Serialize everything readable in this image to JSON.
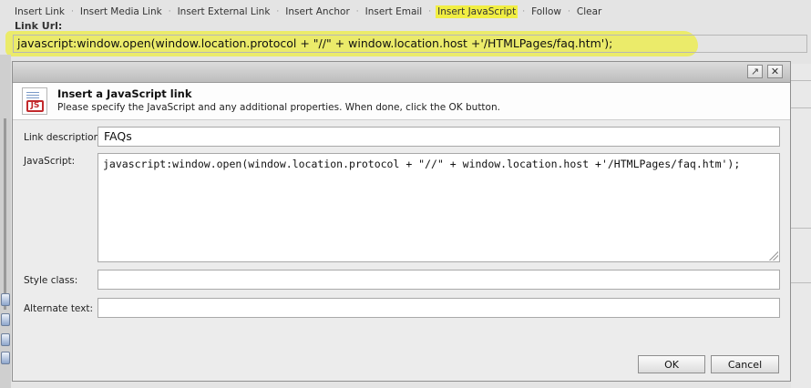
{
  "toolbar": {
    "items": [
      {
        "label": "Insert Link",
        "active": false
      },
      {
        "label": "Insert Media Link",
        "active": false
      },
      {
        "label": "Insert External Link",
        "active": false
      },
      {
        "label": "Insert Anchor",
        "active": false
      },
      {
        "label": "Insert Email",
        "active": false
      },
      {
        "label": "Insert JavaScript",
        "active": true
      },
      {
        "label": "Follow",
        "active": false
      },
      {
        "label": "Clear",
        "active": false
      }
    ],
    "highlight_color": "#f1ee42"
  },
  "link_url": {
    "label": "Link Url:",
    "value": "javascript:window.open(window.location.protocol + \"//\" + window.location.host +'/HTMLPages/faq.htm');"
  },
  "dialog": {
    "icon": "javascript-file-icon",
    "icon_text": "JS",
    "title": "Insert a JavaScript link",
    "subtitle": "Please specify the JavaScript and any additional properties. When done, click the OK button.",
    "fields": {
      "link_description": {
        "label": "Link description:",
        "value": "FAQs"
      },
      "javascript": {
        "label": "JavaScript:",
        "value": "javascript:window.open(window.location.protocol + \"//\" + window.location.host +'/HTMLPages/faq.htm');"
      },
      "style_class": {
        "label": "Style class:",
        "value": ""
      },
      "alternate_text": {
        "label": "Alternate text:",
        "value": ""
      }
    },
    "buttons": {
      "ok": "OK",
      "cancel": "Cancel"
    },
    "window_buttons": {
      "maximize": "↗",
      "close": "✕"
    }
  }
}
